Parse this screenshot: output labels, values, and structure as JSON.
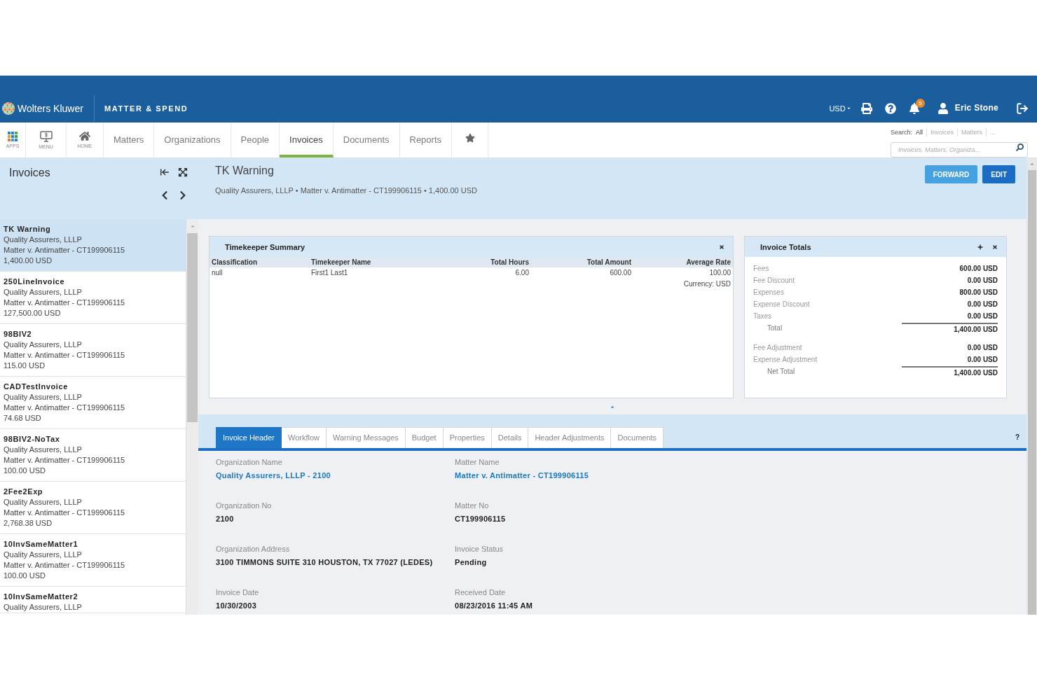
{
  "header": {
    "brand": "Wolters Kluwer",
    "product": "MATTER & SPEND",
    "currency": "USD",
    "notifications": "5",
    "user": "Eric Stone"
  },
  "nav": {
    "shortcuts": [
      {
        "label": "APPS"
      },
      {
        "label": "MENU"
      },
      {
        "label": "HOME"
      }
    ],
    "tabs": [
      {
        "label": "Matters",
        "selected": false
      },
      {
        "label": "Organizations",
        "selected": false
      },
      {
        "label": "People",
        "selected": false
      },
      {
        "label": "Invoices",
        "selected": true
      },
      {
        "label": "Documents",
        "selected": false
      },
      {
        "label": "Reports",
        "selected": false
      }
    ],
    "search": {
      "label": "Search:",
      "scopes": [
        {
          "label": "All",
          "selected": true
        },
        {
          "label": "Invoices",
          "selected": false
        },
        {
          "label": "Matters",
          "selected": false
        },
        {
          "label": "...",
          "selected": false
        }
      ],
      "placeholder": "Invoices, Matters, Organiza..."
    }
  },
  "sidebar": {
    "title": "Invoices",
    "items": [
      {
        "name": "TK Warning",
        "organization": "Quality Assurers, LLLP",
        "matter": "Matter v. Antimatter - CT199906115",
        "amount": "1,400.00 USD",
        "selected": true
      },
      {
        "name": "250LineInvoice",
        "organization": "Quality Assurers, LLLP",
        "matter": "Matter v. Antimatter - CT199906115",
        "amount": "127,500.00 USD",
        "selected": false
      },
      {
        "name": "98BIV2",
        "organization": "Quality Assurers, LLLP",
        "matter": "Matter v. Antimatter - CT199906115",
        "amount": "115.00 USD",
        "selected": false
      },
      {
        "name": "CADTestInvoice",
        "organization": "Quality Assurers, LLLP",
        "matter": "Matter v. Antimatter - CT199906115",
        "amount": "74.68 USD",
        "selected": false
      },
      {
        "name": "98BIV2-NoTax",
        "organization": "Quality Assurers, LLLP",
        "matter": "Matter v. Antimatter - CT199906115",
        "amount": "100.00 USD",
        "selected": false
      },
      {
        "name": "2Fee2Exp",
        "organization": "Quality Assurers, LLLP",
        "matter": "Matter v. Antimatter - CT199906115",
        "amount": "2,768.38 USD",
        "selected": false
      },
      {
        "name": "10InvSameMatter1",
        "organization": "Quality Assurers, LLLP",
        "matter": "Matter v. Antimatter - CT199906115",
        "amount": "100.00 USD",
        "selected": false
      },
      {
        "name": "10InvSameMatter2",
        "organization": "Quality Assurers, LLLP",
        "selected": false
      }
    ]
  },
  "detail": {
    "title": "TK Warning",
    "summary": "Quality Assurers, LLLP • Matter v. Antimatter - CT199906115 • 1,400.00 USD",
    "actions": [
      {
        "label": "FORWARD",
        "hovered": false
      },
      {
        "label": "EDIT",
        "hovered": true
      }
    ]
  },
  "timekeeper_summary": {
    "title": "Timekeeper Summary",
    "columns": [
      "Classification",
      "Timekeeper Name",
      "Total Hours",
      "Total Amount",
      "Average Rate"
    ],
    "rows": [
      [
        "null",
        "First1 Last1",
        "6.00",
        "600.00",
        "100.00"
      ]
    ],
    "currency": "Currency: USD"
  },
  "invoice_totals": {
    "title": "Invoice Totals",
    "rows": [
      {
        "label": "Fees",
        "value": "600.00 USD",
        "kind": "line"
      },
      {
        "label": "Fee Discount",
        "value": "0.00 USD",
        "kind": "line"
      },
      {
        "label": "Expenses",
        "value": "800.00 USD",
        "kind": "line"
      },
      {
        "label": "Expense Discount",
        "value": "0.00 USD",
        "kind": "line"
      },
      {
        "label": "Taxes",
        "value": "0.00 USD",
        "kind": "line"
      },
      {
        "label": "Total",
        "value": "1,400.00 USD",
        "kind": "total"
      },
      {
        "label": "Fee Adjustment",
        "value": "0.00 USD",
        "kind": "line"
      },
      {
        "label": "Expense Adjustment",
        "value": "0.00 USD",
        "kind": "line"
      },
      {
        "label": "Net Total",
        "value": "1,400.00 USD",
        "kind": "total"
      }
    ]
  },
  "detail_tabs": [
    {
      "label": "Invoice Header",
      "selected": true
    },
    {
      "label": "Workflow",
      "selected": false
    },
    {
      "label": "Warning Messages",
      "selected": false
    },
    {
      "label": "Budget",
      "selected": false
    },
    {
      "label": "Properties",
      "selected": false
    },
    {
      "label": "Details",
      "selected": false
    },
    {
      "label": "Header Adjustments",
      "selected": false
    },
    {
      "label": "Documents",
      "selected": false
    }
  ],
  "help": "?",
  "fields": [
    {
      "label": "Organization Name",
      "value": "Quality Assurers, LLLP - 2100",
      "kind": "link"
    },
    {
      "label": "Matter Name",
      "value": "Matter v. Antimatter - CT199906115",
      "kind": "link"
    },
    {
      "label": "Organization No",
      "value": "2100",
      "kind": "text"
    },
    {
      "label": "Matter No",
      "value": "CT199906115",
      "kind": "text"
    },
    {
      "label": "Organization Address",
      "value": "3100 TIMMONS SUITE 310 HOUSTON, TX 77027 (LEDES)",
      "kind": "text"
    },
    {
      "label": "Invoice Status",
      "value": "Pending",
      "kind": "text"
    },
    {
      "label": "Invoice Date",
      "value": "10/30/2003",
      "kind": "text"
    },
    {
      "label": "Received Date",
      "value": "08/23/2016 11:45 AM",
      "kind": "text"
    }
  ]
}
